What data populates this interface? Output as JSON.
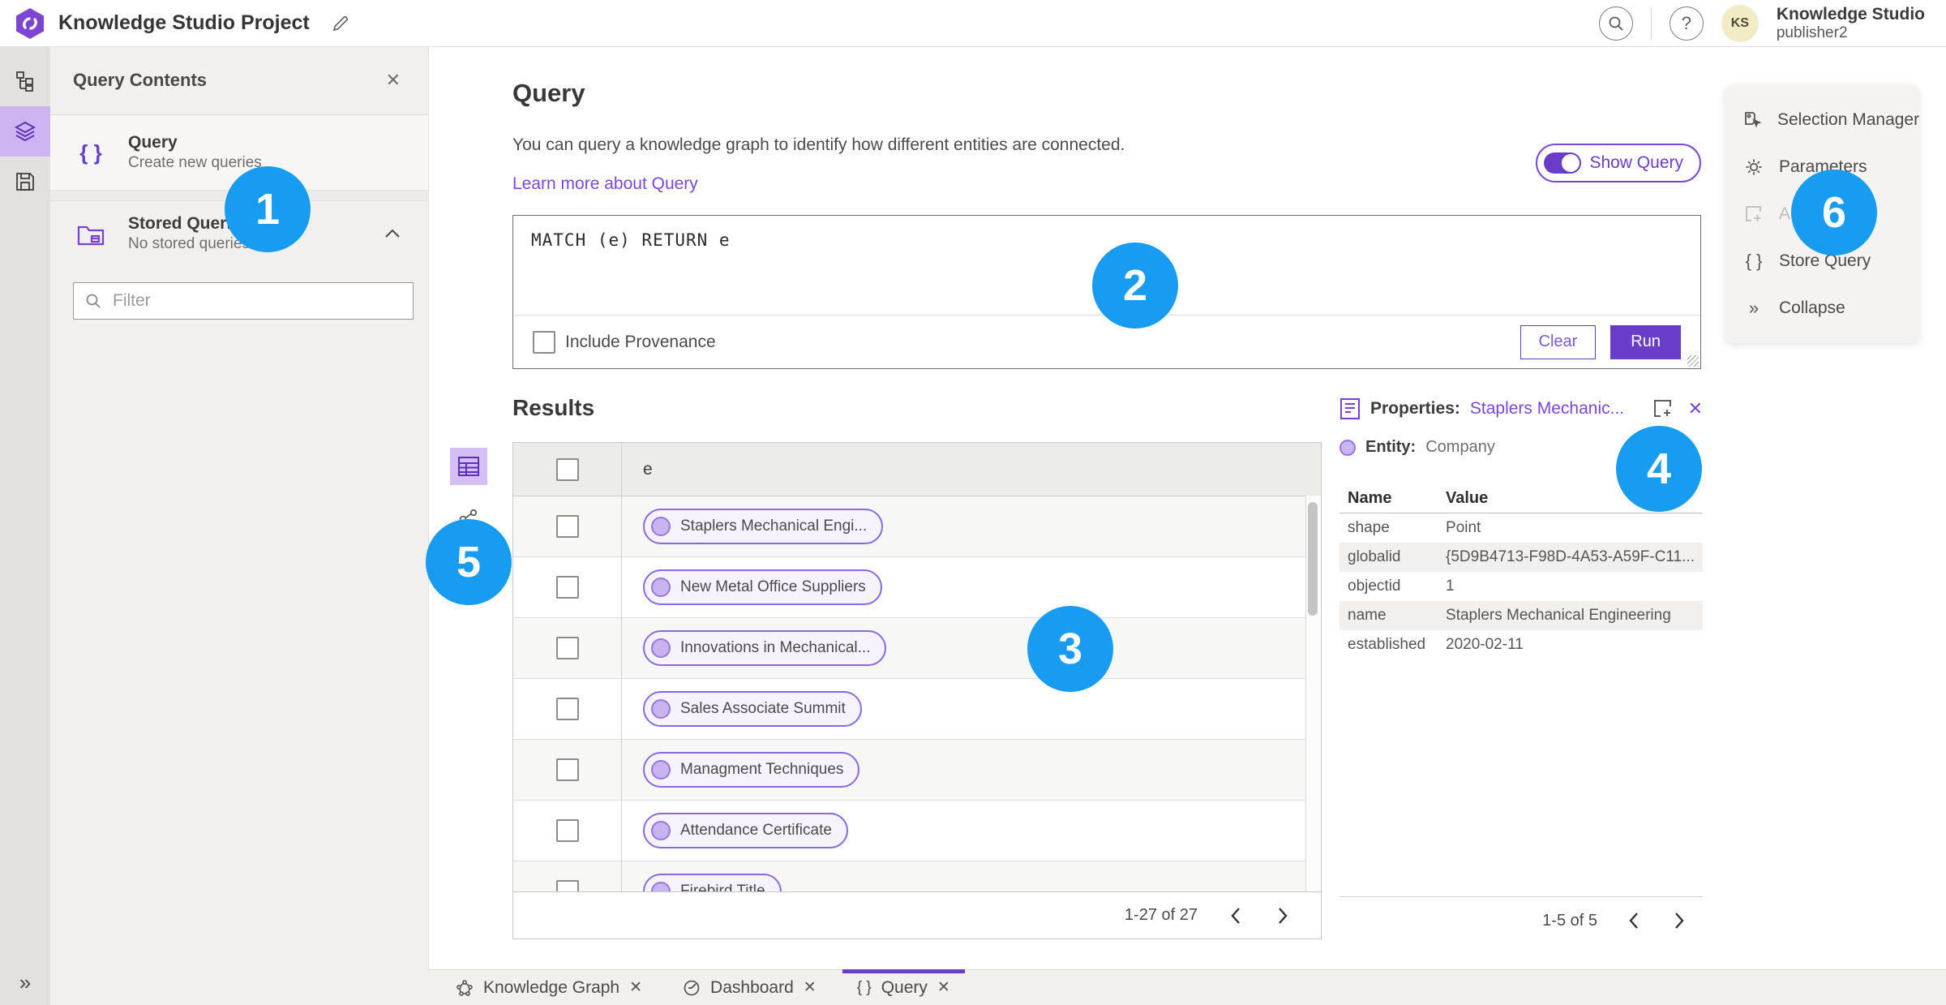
{
  "header": {
    "title": "Knowledge Studio Project",
    "user": {
      "initials": "KS",
      "name": "Knowledge Studio",
      "subtitle": "publisher2"
    }
  },
  "contents_panel": {
    "title": "Query Contents",
    "items": [
      {
        "label": "Query",
        "sublabel": "Create new queries"
      },
      {
        "label": "Stored Queries",
        "sublabel": "No stored queries exist"
      }
    ],
    "filter_placeholder": "Filter"
  },
  "query_section": {
    "title": "Query",
    "description": "You can query a knowledge graph to identify how different entities are connected.",
    "learn_more": "Learn more about Query",
    "show_query_label": "Show Query",
    "code": "MATCH (e) RETURN e",
    "include_provenance_label": "Include Provenance",
    "clear_label": "Clear",
    "run_label": "Run"
  },
  "results": {
    "title": "Results",
    "column_header": "e",
    "rows": [
      {
        "label": "Staplers Mechanical Engi..."
      },
      {
        "label": "New Metal Office Suppliers"
      },
      {
        "label": "Innovations in Mechanical..."
      },
      {
        "label": "Sales Associate Summit"
      },
      {
        "label": "Managment Techniques"
      },
      {
        "label": "Attendance Certificate"
      },
      {
        "label": "Firebird Title"
      }
    ],
    "pagination": "1-27 of 27"
  },
  "properties": {
    "title": "Properties:",
    "entity_link": "Staplers Mechanic...",
    "entity_label": "Entity:",
    "entity_type": "Company",
    "columns": {
      "name": "Name",
      "value": "Value"
    },
    "rows": [
      {
        "name": "shape",
        "value": "Point"
      },
      {
        "name": "globalid",
        "value": "{5D9B4713-F98D-4A53-A59F-C11..."
      },
      {
        "name": "objectid",
        "value": "1"
      },
      {
        "name": "name",
        "value": "Staplers Mechanical Engineering"
      },
      {
        "name": "established",
        "value": "2020-02-11"
      }
    ],
    "pagination": "1-5 of 5"
  },
  "side_menu": {
    "items": [
      {
        "label": "Selection Manager"
      },
      {
        "label": "Parameters"
      },
      {
        "label": "Ad",
        "disabled": true
      },
      {
        "label": "Store Query"
      },
      {
        "label": "Collapse"
      }
    ]
  },
  "tabs": [
    {
      "label": "Knowledge Graph"
    },
    {
      "label": "Dashboard"
    },
    {
      "label": "Query",
      "active": true
    }
  ],
  "annotations": [
    "1",
    "2",
    "3",
    "4",
    "5",
    "6"
  ],
  "icons": {
    "help": "?",
    "close": "✕",
    "curly": "{ }",
    "collapse": "»"
  },
  "colors": {
    "accent_purple": "#6a3dc8",
    "link_purple": "#7747d8",
    "annotation_blue": "#189cf2"
  }
}
